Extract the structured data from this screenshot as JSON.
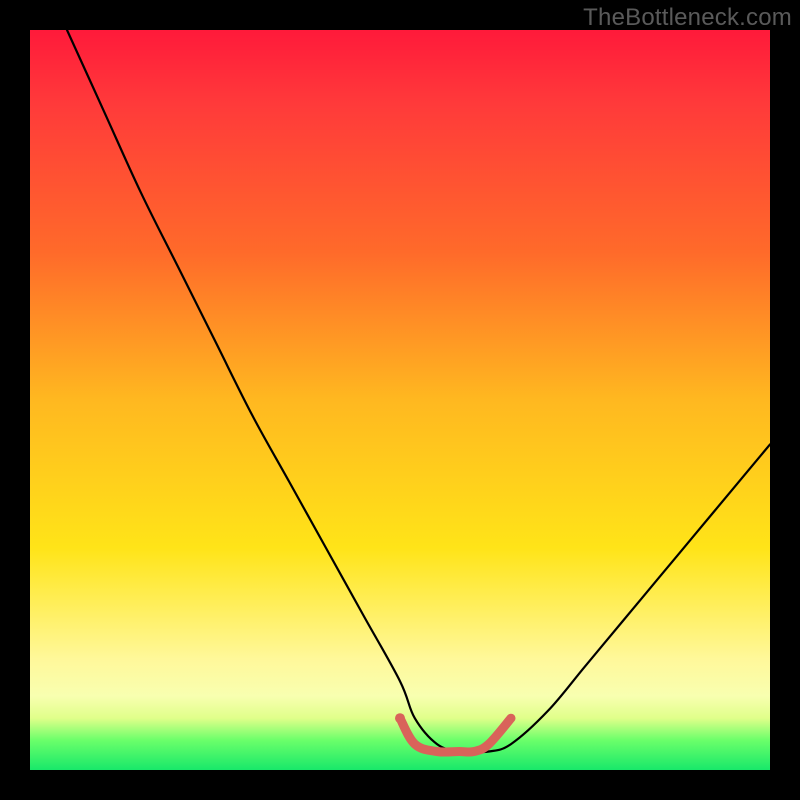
{
  "watermark": "TheBottleneck.com",
  "chart_data": {
    "type": "line",
    "title": "",
    "xlabel": "",
    "ylabel": "",
    "xlim": [
      0,
      100
    ],
    "ylim": [
      0,
      100
    ],
    "series": [
      {
        "name": "curve",
        "x": [
          5,
          10,
          15,
          20,
          25,
          30,
          35,
          40,
          45,
          50,
          52,
          55,
          58,
          60,
          62,
          65,
          70,
          75,
          80,
          85,
          90,
          95,
          100
        ],
        "y": [
          100,
          89,
          78,
          68,
          58,
          48,
          39,
          30,
          21,
          12,
          7,
          3.5,
          2.5,
          2.5,
          2.5,
          3.5,
          8,
          14,
          20,
          26,
          32,
          38,
          44
        ]
      },
      {
        "name": "bottom-dip",
        "x": [
          50,
          52,
          55,
          58,
          60,
          62,
          65
        ],
        "y": [
          7,
          3.5,
          2.5,
          2.5,
          2.5,
          3.5,
          7
        ]
      }
    ],
    "colors": {
      "curve": "#000000",
      "bottom_dip": "#d9635a"
    }
  }
}
